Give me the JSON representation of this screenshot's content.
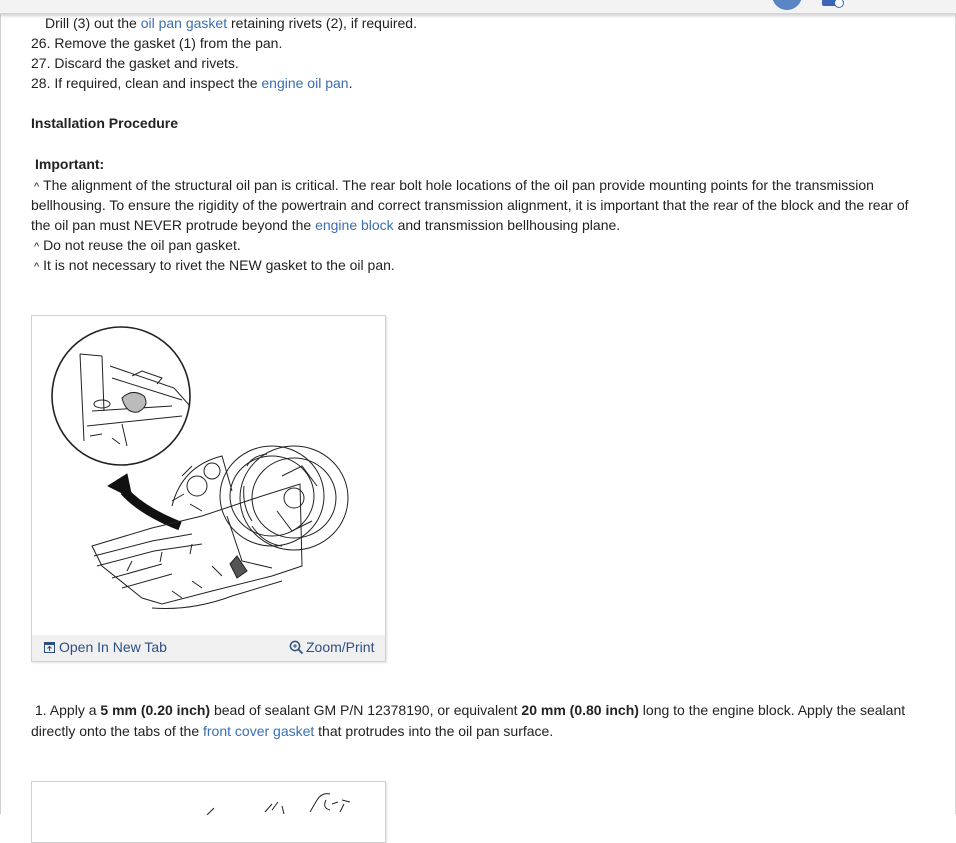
{
  "step25": {
    "pre": "Drill (3) out the ",
    "link": "oil pan gasket",
    "post": " retaining rivets (2), if required."
  },
  "step26": "26. Remove the gasket (1) from the pan.",
  "step27": "27. Discard the gasket and rivets.",
  "step28": {
    "pre": "28. If required, clean and inspect the ",
    "link": "engine oil pan",
    "post": "."
  },
  "installation_heading": "Installation Procedure",
  "important_label": "Important:",
  "bullet_char": "^",
  "important": {
    "p1_line1": "The alignment of the structural oil pan is critical. The rear bolt hole locations of the oil pan provide mounting points for the transmission",
    "p1_line2": "bellhousing. To ensure the rigidity of the powertrain and correct transmission alignment, it is important that the rear of the block and the rear of",
    "p1_line3_pre": "the oil pan must NEVER protrude beyond the ",
    "p1_line3_link": "engine block",
    "p1_line3_post": " and transmission bellhousing plane.",
    "b2": "Do not reuse the oil pan gasket.",
    "b3": "It is not necessary to rivet the NEW gasket to the oil pan."
  },
  "figure": {
    "open_new_tab": "Open In New Tab",
    "zoom_print": "Zoom/Print"
  },
  "step1": {
    "a": "1. Apply a ",
    "b": "5 mm (0.20 inch)",
    "c": " bead of sealant GM P/N 12378190, or equivalent ",
    "d": "20 mm (0.80 inch)",
    "e": " long to the engine block. Apply the sealant",
    "line2_pre": "directly onto the tabs of the ",
    "line2_link": "front cover gasket",
    "line2_post": " that protrudes into the oil pan surface."
  },
  "colors": {
    "link": "#3a6fb0",
    "accent": "#5b86c5"
  }
}
